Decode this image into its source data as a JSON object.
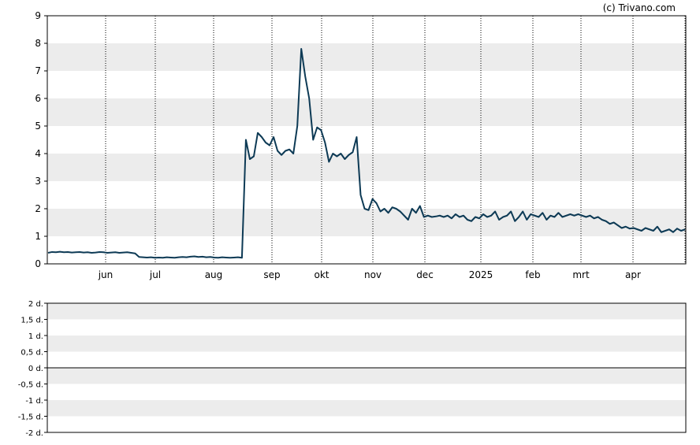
{
  "credit": "(c) Trivano.com",
  "chart_data": [
    {
      "type": "line",
      "ylim": [
        0,
        9
      ],
      "y_ticks": [
        "0",
        "1",
        "2",
        "3",
        "4",
        "5",
        "6",
        "7",
        "8",
        "9"
      ],
      "x_ticks": [
        "jun",
        "jul",
        "aug",
        "sep",
        "okt",
        "nov",
        "dec",
        "2025",
        "feb",
        "mrt",
        "apr"
      ],
      "grid": "alternating horizontal bands, dotted vertical month lines",
      "line_color": "#0d3a55",
      "series": [
        {
          "values": [
            0.4,
            0.43,
            0.42,
            0.44,
            0.42,
            0.43,
            0.41,
            0.42,
            0.43,
            0.41,
            0.42,
            0.4,
            0.41,
            0.43,
            0.42,
            0.4,
            0.41,
            0.42,
            0.4,
            0.41,
            0.42,
            0.4,
            0.38,
            0.25,
            0.24,
            0.23,
            0.24,
            0.22,
            0.23,
            0.22,
            0.24,
            0.23,
            0.22,
            0.24,
            0.25,
            0.24,
            0.26,
            0.27,
            0.25,
            0.26,
            0.24,
            0.25,
            0.23,
            0.22,
            0.24,
            0.23,
            0.22,
            0.23,
            0.24,
            0.22,
            4.5,
            3.8,
            3.9,
            4.75,
            4.6,
            4.4,
            4.3,
            4.6,
            4.1,
            3.95,
            4.1,
            4.15,
            4.0,
            5.0,
            7.8,
            6.8,
            6.0,
            4.5,
            4.95,
            4.85,
            4.4,
            3.7,
            4.0,
            3.9,
            4.0,
            3.8,
            3.95,
            4.05,
            4.6,
            2.5,
            2.0,
            1.95,
            2.35,
            2.2,
            1.9,
            2.0,
            1.85,
            2.05,
            2.0,
            1.9,
            1.75,
            1.6,
            2.0,
            1.85,
            2.1,
            1.7,
            1.75,
            1.7,
            1.72,
            1.75,
            1.7,
            1.75,
            1.65,
            1.8,
            1.7,
            1.75,
            1.6,
            1.55,
            1.7,
            1.65,
            1.8,
            1.7,
            1.75,
            1.9,
            1.6,
            1.7,
            1.75,
            1.9,
            1.55,
            1.7,
            1.9,
            1.6,
            1.8,
            1.75,
            1.7,
            1.85,
            1.6,
            1.75,
            1.7,
            1.85,
            1.7,
            1.75,
            1.8,
            1.75,
            1.8,
            1.75,
            1.7,
            1.75,
            1.65,
            1.7,
            1.6,
            1.55,
            1.45,
            1.5,
            1.4,
            1.3,
            1.35,
            1.28,
            1.3,
            1.25,
            1.2,
            1.3,
            1.25,
            1.2,
            1.35,
            1.15,
            1.2,
            1.25,
            1.15,
            1.28,
            1.2,
            1.25
          ]
        }
      ]
    },
    {
      "type": "line",
      "ylim": [
        -2,
        2
      ],
      "y_ticks": [
        "2 d.",
        "1,5 d.",
        "1 d.",
        "0,5 d.",
        "0 d.",
        "-0,5 d.",
        "-1 d.",
        "-1,5 d.",
        "-2 d."
      ],
      "grid": "alternating horizontal bands",
      "series": []
    }
  ]
}
